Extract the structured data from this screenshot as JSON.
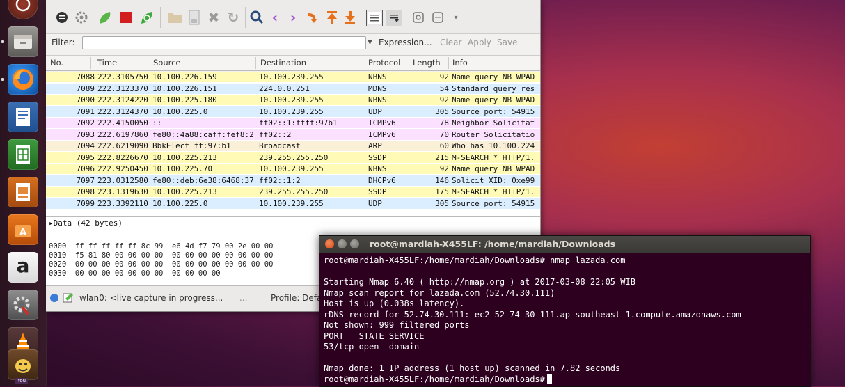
{
  "launcher": {
    "icons": [
      "dash-icon",
      "files-icon",
      "firefox-icon",
      "writer-icon",
      "calc-icon",
      "impress-icon",
      "software-center-icon",
      "amazon-icon",
      "settings-icon",
      "vlc-icon",
      "installer-icon"
    ],
    "amazon_letter": "a",
    "bottom_badge": "You"
  },
  "wireshark": {
    "filter": {
      "label": "Filter:",
      "value": "",
      "expression": "Expression...",
      "clear": "Clear",
      "apply": "Apply",
      "save": "Save"
    },
    "columns": [
      "No.",
      "Time",
      "Source",
      "Destination",
      "Protocol",
      "Length",
      "Info"
    ],
    "rows": [
      {
        "no": "7088",
        "time": "222.3105750",
        "src": "10.100.226.159",
        "dst": "10.100.239.255",
        "proto": "NBNS",
        "len": "92",
        "info": "Name query NB WPAD",
        "color": "#fffbb6"
      },
      {
        "no": "7089",
        "time": "222.3123370",
        "src": "10.100.226.151",
        "dst": "224.0.0.251",
        "proto": "MDNS",
        "len": "54",
        "info": "Standard query res",
        "color": "#daeeff"
      },
      {
        "no": "7090",
        "time": "222.3124220",
        "src": "10.100.225.180",
        "dst": "10.100.239.255",
        "proto": "NBNS",
        "len": "92",
        "info": "Name query NB WPAD",
        "color": "#fffbb6"
      },
      {
        "no": "7091",
        "time": "222.3124370",
        "src": "10.100.225.0",
        "dst": "10.100.239.255",
        "proto": "UDP",
        "len": "305",
        "info": "Source port: 54915",
        "color": "#daeeff"
      },
      {
        "no": "7092",
        "time": "222.4150050",
        "src": "::",
        "dst": "ff02::1:ffff:97b1",
        "proto": "ICMPv6",
        "len": "78",
        "info": "Neighbor Solicitat",
        "color": "#fce0ff"
      },
      {
        "no": "7093",
        "time": "222.6197860",
        "src": "fe80::4a88:caff:fef8:2",
        "dst": "ff02::2",
        "proto": "ICMPv6",
        "len": "70",
        "info": "Router Solicitatio",
        "color": "#fce0ff"
      },
      {
        "no": "7094",
        "time": "222.6219090",
        "src": "BbkElect_ff:97:b1",
        "dst": "Broadcast",
        "proto": "ARP",
        "len": "60",
        "info": "Who has 10.100.224",
        "color": "#faf0d7"
      },
      {
        "no": "7095",
        "time": "222.8226670",
        "src": "10.100.225.213",
        "dst": "239.255.255.250",
        "proto": "SSDP",
        "len": "215",
        "info": "M-SEARCH * HTTP/1.",
        "color": "#fffbb6"
      },
      {
        "no": "7096",
        "time": "222.9250450",
        "src": "10.100.225.70",
        "dst": "10.100.239.255",
        "proto": "NBNS",
        "len": "92",
        "info": "Name query NB WPAD",
        "color": "#fffbb6"
      },
      {
        "no": "7097",
        "time": "223.0312580",
        "src": "fe80::deb:6e38:6468:37",
        "dst": "ff02::1:2",
        "proto": "DHCPv6",
        "len": "146",
        "info": "Solicit XID: 0xe99",
        "color": "#daeeff"
      },
      {
        "no": "7098",
        "time": "223.1319630",
        "src": "10.100.225.213",
        "dst": "239.255.255.250",
        "proto": "SSDP",
        "len": "175",
        "info": "M-SEARCH * HTTP/1.",
        "color": "#fffbb6"
      },
      {
        "no": "7099",
        "time": "223.3392110",
        "src": "10.100.225.0",
        "dst": "10.100.239.255",
        "proto": "UDP",
        "len": "305",
        "info": "Source port: 54915",
        "color": "#daeeff"
      }
    ],
    "detail": "▸Data (42 bytes)",
    "hex": [
      "0000  ff ff ff ff ff 8c 99  e6 4d f7 79 00 2e 00 00",
      "0010  f5 81 80 00 00 00 00  00 00 00 00 00 00 00 00",
      "0020  00 00 00 00 00 00 00  00 00 00 00 00 00 00 00",
      "0030  00 00 00 00 00 00 00  00 00 00 00"
    ],
    "status": {
      "capture": "wlan0: <live capture in progress...",
      "dots": "...",
      "profile": "Profile: Defa"
    }
  },
  "terminal": {
    "title": "root@mardiah-X455LF: /home/mardiah/Downloads",
    "lines": [
      "root@mardiah-X455LF:/home/mardiah/Downloads# nmap lazada.com",
      "",
      "Starting Nmap 6.40 ( http://nmap.org ) at 2017-03-08 22:05 WIB",
      "Nmap scan report for lazada.com (52.74.30.111)",
      "Host is up (0.038s latency).",
      "rDNS record for 52.74.30.111: ec2-52-74-30-111.ap-southeast-1.compute.amazonaws.com",
      "Not shown: 999 filtered ports",
      "PORT   STATE SERVICE",
      "53/tcp open  domain",
      "",
      "Nmap done: 1 IP address (1 host up) scanned in 7.82 seconds"
    ],
    "prompt": "root@mardiah-X455LF:/home/mardiah/Downloads#"
  }
}
